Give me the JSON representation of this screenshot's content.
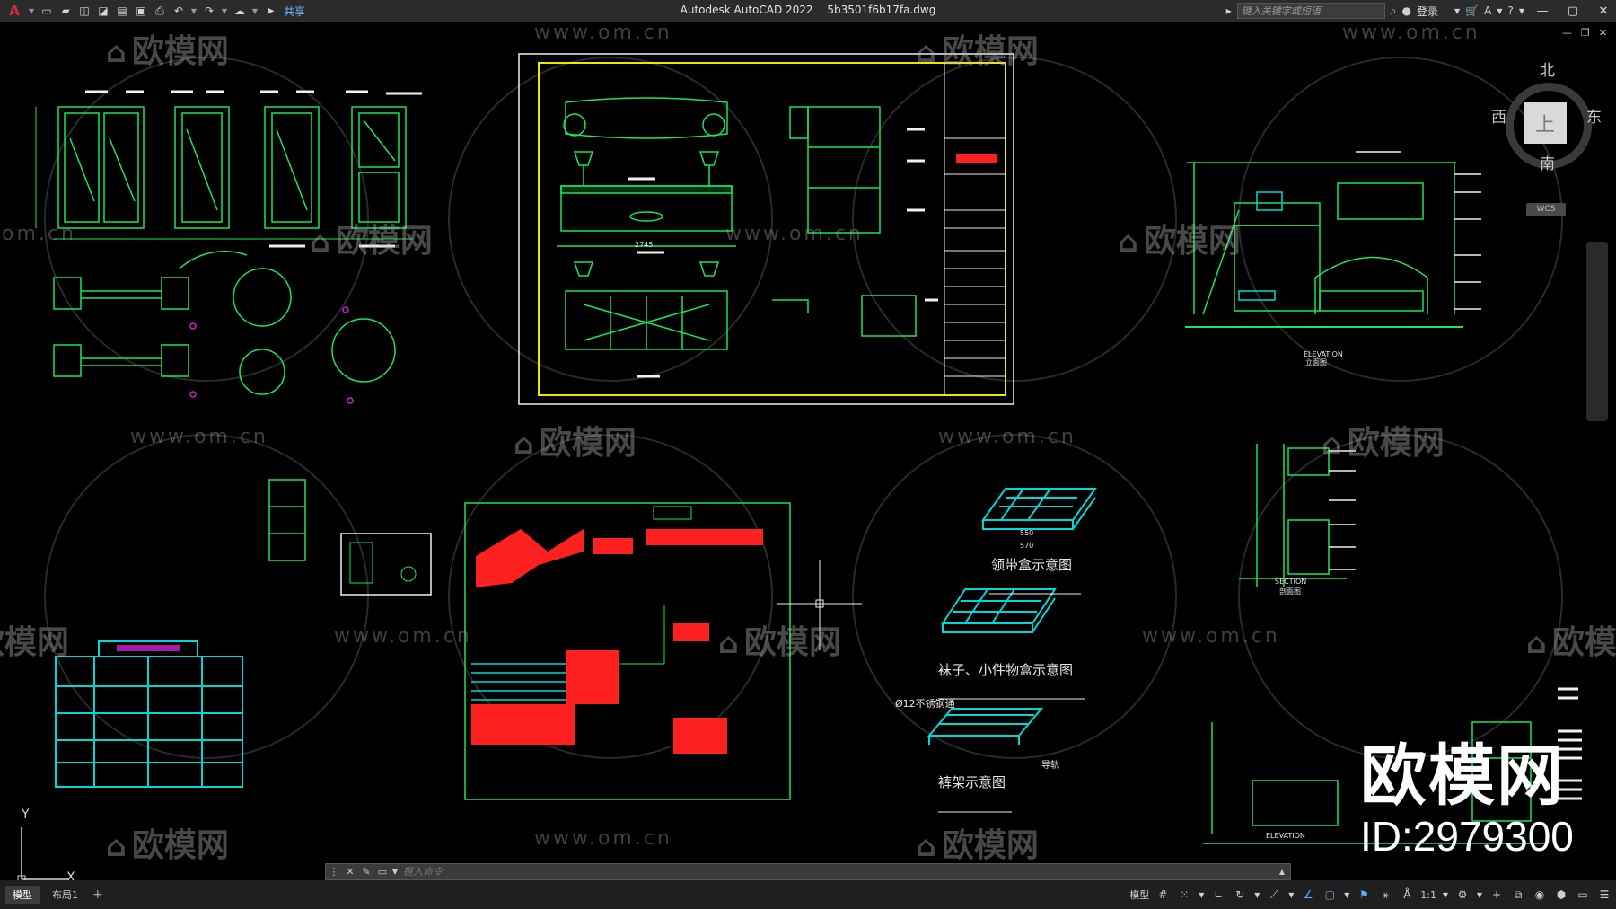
{
  "app": {
    "name": "Autodesk AutoCAD 2022",
    "file": "5b3501f6b17fa.dwg"
  },
  "quick_access": {
    "share_label": "共享"
  },
  "search": {
    "placeholder": "键入关键字或短语"
  },
  "account": {
    "login_label": "登录"
  },
  "viewcube": {
    "north": "北",
    "south": "南",
    "west": "西",
    "east": "东",
    "face": "上",
    "wcs": "WCS"
  },
  "ucs": {
    "x": "X",
    "y": "Y"
  },
  "watermarks": {
    "url": "www.om.cn",
    "site_cn": "欧模网",
    "url_partial": "om.cn"
  },
  "drawing_labels": {
    "tie_box": "领带盒示意图",
    "socks_box": "袜子、小件物盒示意图",
    "pants_rack": "裤架示意图",
    "pipe_label": "Ø12不锈钢通",
    "rail_label": "导轨",
    "elevation": "ELEVATION",
    "elevation_cn": "立面图",
    "section": "SECTION",
    "section_cn": "剖面图",
    "dim_550": "550",
    "dim_570": "570",
    "dim_2745": "2745"
  },
  "brand": {
    "name": "欧模网",
    "id": "ID:2979300"
  },
  "command": {
    "placeholder": "键入命令"
  },
  "layout_tabs": [
    {
      "label": "模型",
      "active": true
    },
    {
      "label": "布局1",
      "active": false
    }
  ],
  "status": {
    "model_label": "模型",
    "scale": "1:1"
  },
  "colors": {
    "green": "#19e65a",
    "cyan": "#00d8d8",
    "yellow": "#f2e600",
    "red": "#ff2020",
    "white": "#f0f0f0",
    "magenta": "#d020d0"
  }
}
